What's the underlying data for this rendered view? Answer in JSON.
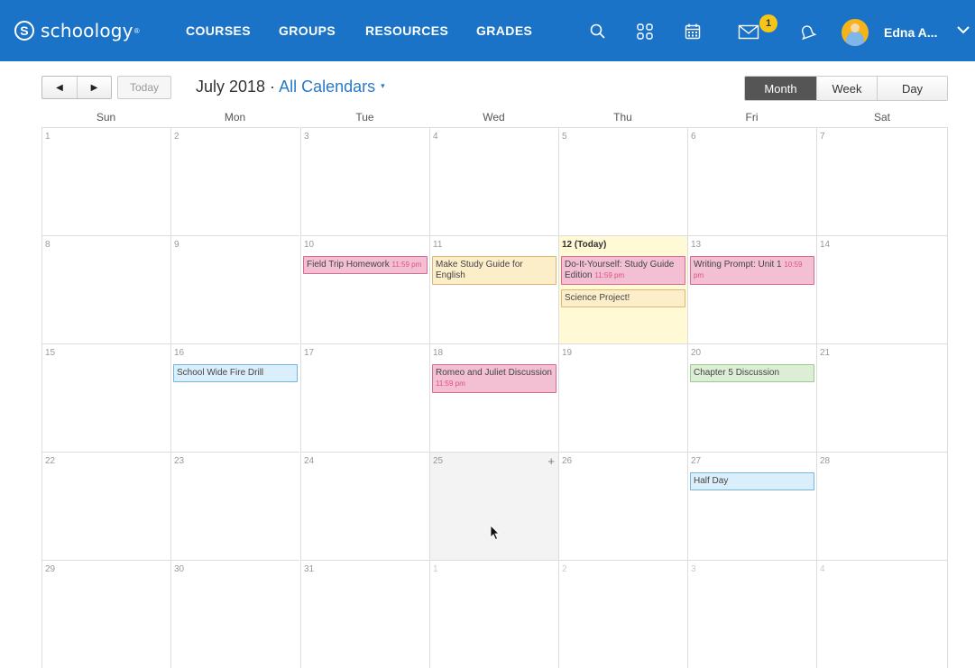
{
  "header": {
    "logo_text": "schoology",
    "logo_tm": "®",
    "nav": [
      "COURSES",
      "GROUPS",
      "RESOURCES",
      "GRADES"
    ],
    "icons": [
      "search-icon",
      "apps-grid-icon",
      "calendar-icon",
      "mail-icon",
      "bell-icon"
    ],
    "mail_badge": "1",
    "user_name": "Edna A...",
    "brand_color": "#1a73c7"
  },
  "toolbar": {
    "prev_label": "◀",
    "next_label": "▶",
    "today_label": "Today",
    "month_label": "July 2018 · ",
    "calendar_filter": "All Calendars",
    "caret": "▾",
    "views": [
      "Month",
      "Week",
      "Day"
    ],
    "active_view": "Month"
  },
  "calendar": {
    "weekdays": [
      "Sun",
      "Mon",
      "Tue",
      "Wed",
      "Thu",
      "Fri",
      "Sat"
    ],
    "weeks": [
      [
        "1",
        "2",
        "3",
        "4",
        "5",
        "6",
        "7"
      ],
      [
        "8",
        "9",
        "10",
        "11",
        "12 (Today)",
        "13",
        "14"
      ],
      [
        "15",
        "16",
        "17",
        "18",
        "19",
        "20",
        "21"
      ],
      [
        "22",
        "23",
        "24",
        "25",
        "26",
        "27",
        "28"
      ],
      [
        "29",
        "30",
        "31",
        "1",
        "2",
        "3",
        "4"
      ]
    ],
    "today_cell": [
      1,
      4
    ],
    "hover_cell": [
      3,
      3
    ],
    "events": [
      {
        "week": 1,
        "day": 2,
        "slot": 0,
        "title": "Field Trip Homework",
        "time": "11:59 pm",
        "color": "pink"
      },
      {
        "week": 1,
        "day": 3,
        "slot": 0,
        "title": "Make Study Guide for English",
        "time": "",
        "color": "yellow"
      },
      {
        "week": 1,
        "day": 4,
        "slot": 0,
        "title": "Do-It-Yourself: Study Guide Edition",
        "time": "11:59 pm",
        "color": "pink"
      },
      {
        "week": 1,
        "day": 4,
        "slot": 1,
        "title": "Science Project!",
        "time": "",
        "color": "yellow"
      },
      {
        "week": 1,
        "day": 5,
        "slot": 0,
        "title": "Writing Prompt: Unit 1",
        "time": "10:59 pm",
        "color": "pink"
      },
      {
        "week": 2,
        "day": 1,
        "slot": 0,
        "title": "School Wide Fire Drill",
        "time": "",
        "color": "blue"
      },
      {
        "week": 2,
        "day": 3,
        "slot": 0,
        "title": "Romeo and Juliet Discussion",
        "time": "11:59 pm",
        "color": "pink"
      },
      {
        "week": 2,
        "day": 5,
        "slot": 0,
        "title": "Chapter 5 Discussion",
        "time": "",
        "color": "green"
      },
      {
        "week": 3,
        "day": 5,
        "slot": 0,
        "title": "Half Day",
        "time": "",
        "color": "blue"
      }
    ],
    "add_icon": "+"
  }
}
